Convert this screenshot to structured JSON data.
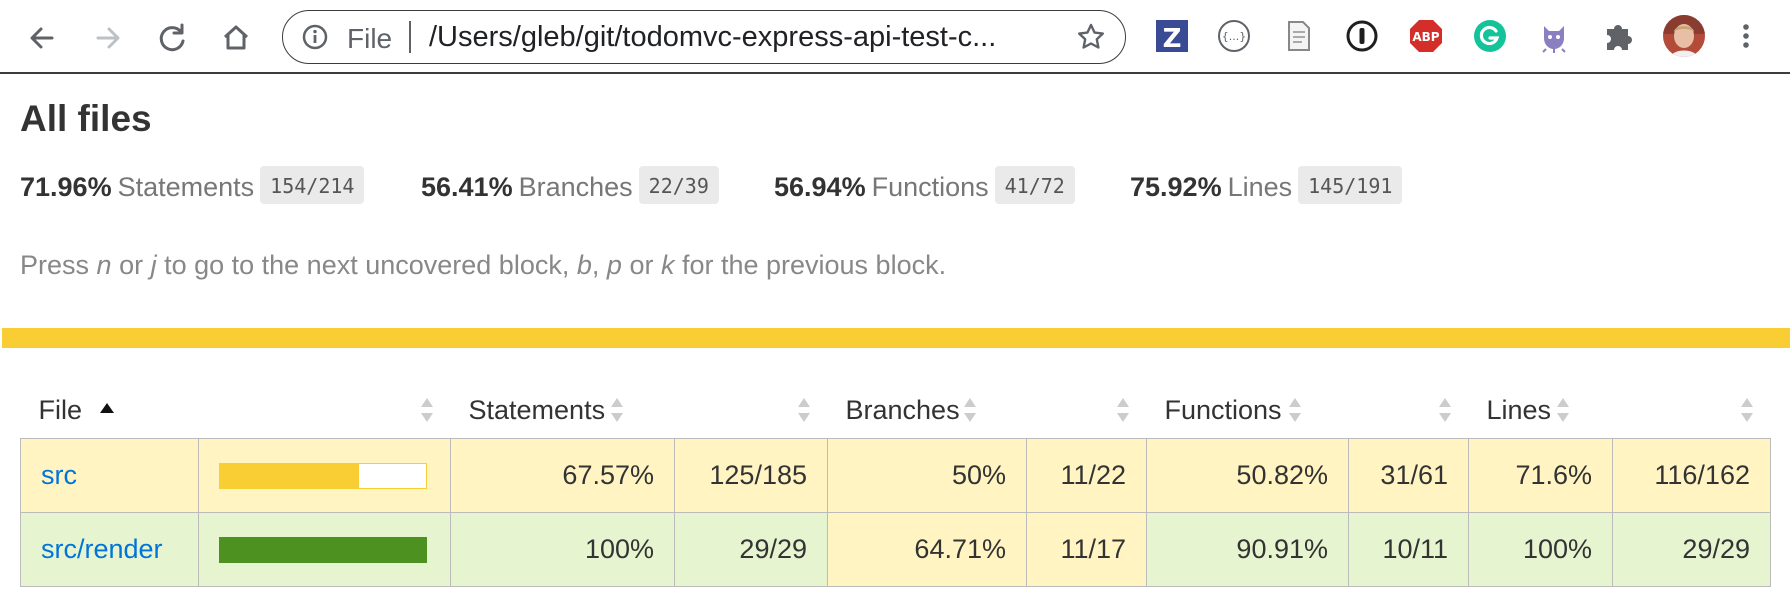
{
  "browser": {
    "omnibox": {
      "scheme_label": "File",
      "url": "/Users/gleb/git/todomvc-express-api-test-c..."
    },
    "icons": {
      "back": "back-arrow-icon",
      "forward": "forward-arrow-icon",
      "reload": "reload-icon",
      "home": "home-icon",
      "info": "info-icon",
      "star": "bookmark-star-icon"
    },
    "extensions": [
      {
        "name": "zotero-extension-icon",
        "text": "Z"
      },
      {
        "name": "json-viewer-extension-icon",
        "text": "{...}"
      },
      {
        "name": "document-extension-icon",
        "text": ""
      },
      {
        "name": "1password-extension-icon",
        "text": ""
      },
      {
        "name": "adblock-plus-extension-icon",
        "text": "ABP"
      },
      {
        "name": "grammarly-extension-icon",
        "text": ""
      },
      {
        "name": "octocat-extension-icon",
        "text": ""
      },
      {
        "name": "extensions-puzzle-icon",
        "text": ""
      },
      {
        "name": "profile-avatar",
        "text": ""
      },
      {
        "name": "chrome-menu-icon",
        "text": ""
      }
    ]
  },
  "page": {
    "title": "All files",
    "summary": [
      {
        "pct": "71.96%",
        "label": "Statements",
        "frac": "154/214"
      },
      {
        "pct": "56.41%",
        "label": "Branches",
        "frac": "22/39"
      },
      {
        "pct": "56.94%",
        "label": "Functions",
        "frac": "41/72"
      },
      {
        "pct": "75.92%",
        "label": "Lines",
        "frac": "145/191"
      }
    ],
    "hint": {
      "p1": "Press ",
      "k1": "n",
      "p2": " or ",
      "k2": "j",
      "p3": " to go to the next uncovered block, ",
      "k3": "b",
      "p4": ", ",
      "k4": "p",
      "p5": " or ",
      "k5": "k",
      "p6": " for the previous block."
    },
    "status_color": "#f9cd34"
  },
  "table": {
    "headers": {
      "file": "File",
      "statements": "Statements",
      "branches": "Branches",
      "functions": "Functions",
      "lines": "Lines"
    },
    "sort_indicator": "sort-ascending-icon",
    "rows": [
      {
        "file": "src",
        "coverage_fraction": 0.6757,
        "bar_color": "#f9cd34",
        "statements_pct": "67.57%",
        "statements_frac": "125/185",
        "branches_pct": "50%",
        "branches_frac": "11/22",
        "functions_pct": "50.82%",
        "functions_frac": "31/61",
        "lines_pct": "71.6%",
        "lines_frac": "116/162"
      },
      {
        "file": "src/render",
        "coverage_fraction": 1.0,
        "bar_color": "#4d9221",
        "statements_pct": "100%",
        "statements_frac": "29/29",
        "branches_pct": "64.71%",
        "branches_frac": "11/17",
        "functions_pct": "90.91%",
        "functions_frac": "10/11",
        "lines_pct": "100%",
        "lines_frac": "29/29"
      }
    ]
  }
}
